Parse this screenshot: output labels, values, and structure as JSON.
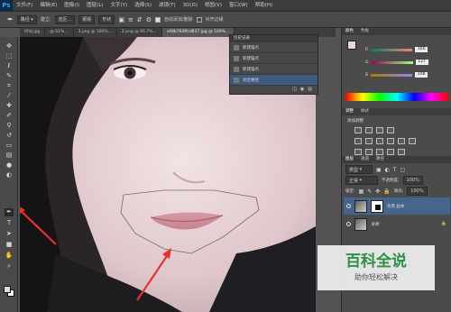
{
  "app": {
    "logo": "Ps"
  },
  "menu": [
    "文件(F)",
    "编辑(E)",
    "图像(I)",
    "图层(L)",
    "文字(Y)",
    "选择(S)",
    "滤镜(T)",
    "3D(D)",
    "视图(V)",
    "窗口(W)",
    "帮助(H)"
  ],
  "options": {
    "mode_label": "路径",
    "make_label": "建立:",
    "selection_btn": "选区...",
    "mask_btn": "蒙版",
    "shape_btn": "形状",
    "auto_add_label": "自动添加/删除",
    "align_edges_label": "对齐边缘"
  },
  "tabs": [
    "RfdJ.jpg",
    "@ 61%...",
    "3.png @ 100%...",
    "2.png @ 66.7%...",
    "s48b764ffcd637.jpg @ 100%..."
  ],
  "history": {
    "title": "历史记录",
    "items": [
      "新建锚点",
      "新建锚点",
      "新建锚点",
      "闭合路径"
    ]
  },
  "color_panel": {
    "tabs": [
      "颜色",
      "色板"
    ],
    "r": "160",
    "g": "127",
    "b": "108",
    "r_label": "R",
    "g_label": "G",
    "b_label": "B"
  },
  "adjust_panel": {
    "tabs": [
      "调整",
      "样式"
    ],
    "title": "添加调整"
  },
  "layers_panel": {
    "tabs": [
      "图层",
      "通道",
      "路径"
    ],
    "kind": "类型",
    "blend_mode": "正常",
    "opacity_label": "不透明度:",
    "opacity": "100%",
    "lock_label": "锁定:",
    "fill_label": "填充:",
    "fill": "100%",
    "layers": [
      {
        "name": "背景 副本",
        "selected": true
      },
      {
        "name": "背景",
        "selected": false
      }
    ]
  },
  "watermark": {
    "title": "百科全说",
    "subtitle": "助你轻松解决"
  },
  "colors": {
    "accent": "#46658d",
    "arrow": "#e8322a",
    "watermark_green": "#2f8f43"
  }
}
